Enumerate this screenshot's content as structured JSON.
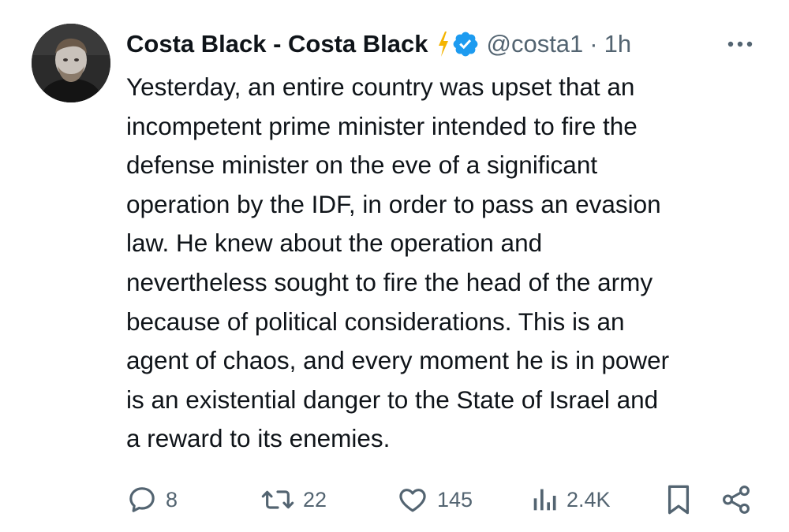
{
  "tweet": {
    "display_name": "Costa Black - Costa Black",
    "handle": "@costa1",
    "separator": "·",
    "time": "1h",
    "body_lines": [
      "Yesterday, an entire country was upset that an",
      "incompetent prime minister intended to fire the",
      "defense minister on the eve of a significant",
      "operation by the IDF, in order to pass an evasion",
      "law. He knew about the operation and",
      "nevertheless sought to fire the head of the army",
      "because of political considerations. This is an",
      "agent of chaos, and every moment he is in power",
      "is an existential danger to the State of Israel and",
      "a reward to its enemies."
    ]
  },
  "actions": {
    "reply_count": "8",
    "retweet_count": "22",
    "like_count": "145",
    "views_count": "2.4K"
  },
  "icons": {
    "avatar": "user-photo",
    "subscription_badge": "lightning-badge-icon",
    "verified_badge": "verified-icon",
    "more": "more-icon",
    "reply": "reply-icon",
    "retweet": "retweet-icon",
    "like": "heart-icon",
    "views": "views-icon",
    "bookmark": "bookmark-icon",
    "share": "share-icon"
  },
  "colors": {
    "text": "#0f1419",
    "secondary": "#536471",
    "verified": "#1d9bf0",
    "badge_gold": "#f4b400"
  }
}
